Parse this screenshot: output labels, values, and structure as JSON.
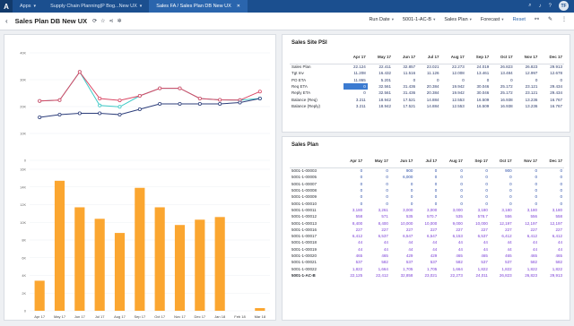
{
  "topbar": {
    "apps": "Apps",
    "crumb1": "Supply Chain Planning|P Bog...New UX",
    "crumb2": "Sales FA / Sales Plan DB New UX",
    "avatar": "TF"
  },
  "toolbar": {
    "title": "Sales Plan DB New UX",
    "filters": [
      "Run Date",
      "5001-1-AC-B",
      "Sales Plan",
      "Forecast"
    ],
    "reset": "Reset"
  },
  "colors": {
    "orange": "#fba630",
    "red": "#d94764",
    "navy": "#2c3d7a",
    "teal": "#3ec9c6",
    "blue": "#3c7bd1"
  },
  "months": [
    "Apr 17",
    "May 17",
    "Jun 17",
    "Jul 17",
    "Aug 17",
    "Sep 17",
    "Oct 17",
    "Nov 17",
    "Dec 17"
  ],
  "psi": {
    "title": "Sales Site PSI",
    "rows": [
      {
        "label": "Sales Plan",
        "values": [
          "22.124",
          "22.411",
          "32.857",
          "23.021",
          "22.273",
          "24.019",
          "26.823",
          "26.823",
          "29.913"
        ]
      },
      {
        "label": "Tgt Inv",
        "values": [
          "11.208",
          "16.432",
          "11.516",
          "11.126",
          "12.008",
          "13.461",
          "13.484",
          "12.997",
          "12.678"
        ]
      },
      {
        "label": "PO ETA",
        "values": [
          "11.865",
          "5.201",
          "0",
          "0",
          "0",
          "0",
          "0",
          "0",
          "0"
        ]
      },
      {
        "label": "Req ETA",
        "values": [
          "0",
          "32.561",
          "31.436",
          "20.384",
          "19.942",
          "30.046",
          "25.172",
          "23.121",
          "29.434"
        ]
      },
      {
        "label": "Reply ETA",
        "values": [
          "0",
          "32.561",
          "31.436",
          "20.384",
          "19.942",
          "30.046",
          "25.172",
          "23.121",
          "29.434"
        ]
      },
      {
        "label": "Balance (Req)",
        "values": [
          "3.211",
          "18.942",
          "17.521",
          "14.884",
          "12.553",
          "16.509",
          "16.938",
          "13.236",
          "16.767"
        ]
      },
      {
        "label": "Balance (Reply)",
        "values": [
          "3.211",
          "18.942",
          "17.521",
          "14.884",
          "12.553",
          "16.509",
          "16.938",
          "13.236",
          "16.767"
        ]
      }
    ]
  },
  "plan": {
    "title": "Sales Plan",
    "rows": [
      {
        "label": "5001-1-00003",
        "values": [
          "0",
          "0",
          "900",
          "0",
          "0",
          "0",
          "900",
          "0",
          "0"
        ]
      },
      {
        "label": "5001-1-00005",
        "values": [
          "0",
          "0",
          "6,000",
          "0",
          "0",
          "0",
          "0",
          "0",
          "0"
        ]
      },
      {
        "label": "5001-1-00007",
        "values": [
          "0",
          "0",
          "0",
          "0",
          "0",
          "0",
          "0",
          "0",
          "0"
        ]
      },
      {
        "label": "5001-1-00008",
        "values": [
          "0",
          "0",
          "0",
          "0",
          "0",
          "0",
          "0",
          "0",
          "0"
        ]
      },
      {
        "label": "5001-1-00009",
        "values": [
          "0",
          "0",
          "0",
          "0",
          "0",
          "0",
          "0",
          "0",
          "0"
        ]
      },
      {
        "label": "5001-1-00010",
        "values": [
          "0",
          "0",
          "0",
          "0",
          "0",
          "0",
          "0",
          "0",
          "0"
        ]
      },
      {
        "label": "5001-1-00011",
        "values": [
          "3,180",
          "3,261",
          "3,000",
          "3,000",
          "3,000",
          "3,180",
          "3,180",
          "3,180",
          "3,180"
        ]
      },
      {
        "label": "5001-1-00012",
        "values": [
          "558",
          "571",
          "535",
          "570.7",
          "535",
          "578.7",
          "556",
          "556",
          "558"
        ]
      },
      {
        "label": "5001-1-00013",
        "values": [
          "8,400",
          "8,400",
          "10,000",
          "10,000",
          "9,000",
          "10,000",
          "12,197",
          "12,197",
          "12,197"
        ]
      },
      {
        "label": "5001-1-00016",
        "values": [
          "227",
          "227",
          "227",
          "227",
          "227",
          "227",
          "227",
          "227",
          "227"
        ]
      },
      {
        "label": "5001-1-00017",
        "values": [
          "6,412",
          "6,537",
          "6,547",
          "6,547",
          "6,153",
          "6,537",
          "6,412",
          "6,412",
          "6,412"
        ]
      },
      {
        "label": "5001-1-00018",
        "values": [
          "44",
          "44",
          "44",
          "44",
          "44",
          "44",
          "44",
          "44",
          "44"
        ]
      },
      {
        "label": "5001-1-00019",
        "values": [
          "44",
          "44",
          "44",
          "44",
          "44",
          "44",
          "44",
          "44",
          "44"
        ]
      },
      {
        "label": "5001-1-00020",
        "values": [
          "465",
          "465",
          "429",
          "429",
          "465",
          "465",
          "465",
          "465",
          "465"
        ]
      },
      {
        "label": "5001-1-00021",
        "values": [
          "537",
          "582",
          "537",
          "537",
          "582",
          "537",
          "537",
          "582",
          "582"
        ]
      },
      {
        "label": "5001-1-00022",
        "values": [
          "1,822",
          "1,664",
          "1,705",
          "1,705",
          "1,664",
          "1,822",
          "1,822",
          "1,822",
          "1,822"
        ]
      },
      {
        "label": "5001-1-AC-B",
        "values": [
          "22,125",
          "22,412",
          "32,858",
          "23,021",
          "22,273",
          "24,011",
          "26,823",
          "26,823",
          "29,913"
        ]
      }
    ]
  },
  "chart_data": {
    "type": "bar",
    "categories": [
      "Apr 17",
      "May 17",
      "Jun 17",
      "Jul 17",
      "Aug 17",
      "Sep 17",
      "Oct 17",
      "Nov 17",
      "Dec 17",
      "Jan 18",
      "Feb 18",
      "Mar 18"
    ],
    "bars": [
      3.4,
      14.7,
      11.7,
      10.4,
      8.8,
      13.9,
      11.7,
      9.7,
      10.3,
      10.6,
      0,
      0.3
    ],
    "bar_ylim": [
      0,
      16
    ],
    "bar_yticks": [
      "0",
      "2K",
      "4K",
      "6K",
      "8K",
      "10K",
      "12K",
      "14K",
      "16K"
    ],
    "line_yticks": [
      "0",
      "10K",
      "20K",
      "30K",
      "40K"
    ],
    "line_ylim": [
      0,
      40
    ],
    "lines": [
      {
        "values": [
          22.1,
          22.4,
          32.9,
          23.0,
          22.3,
          24.0,
          26.8,
          26.8,
          23.0,
          22.5,
          22.4,
          25.6
        ]
      },
      {
        "values": [
          16.0,
          17.0,
          17.5,
          17.5,
          17.0,
          19.0,
          21.0,
          21.0,
          21.0,
          21.0,
          21.5,
          23.0
        ]
      },
      {
        "values": [
          22.1,
          22.4,
          32.9,
          20.4,
          19.9,
          24.0,
          26.8,
          26.8,
          23.0,
          22.5,
          22.4,
          23.0
        ]
      }
    ]
  }
}
